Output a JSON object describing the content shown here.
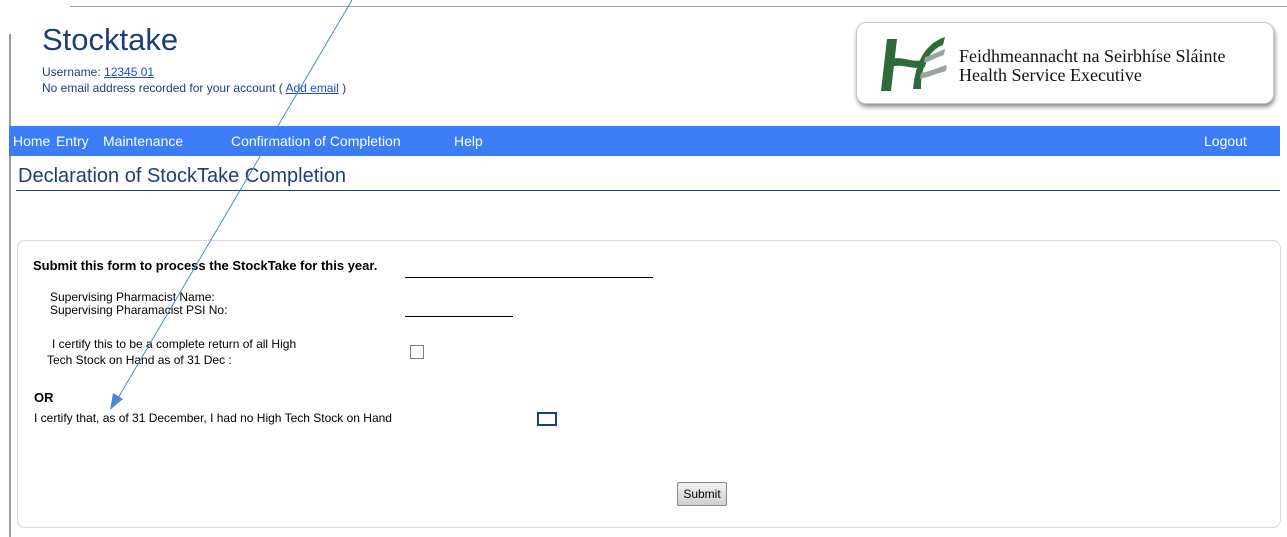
{
  "app": {
    "title": "Stocktake",
    "username_label": "Username:",
    "username_value": "12345 01",
    "email_notice_prefix": "No email address recorded for your account (",
    "email_link": "Add email",
    "email_notice_suffix": ")"
  },
  "logo": {
    "line1": "Feidhmeannacht na Seirbhíse Sláinte",
    "line2": "Health Service Executive"
  },
  "nav": {
    "items": [
      "Home",
      "Entry",
      "Maintenance",
      "Confirmation of Completion",
      "Help"
    ],
    "logout": "Logout",
    "bar_color": "#3b7df6"
  },
  "page": {
    "heading": "Declaration of StockTake Completion"
  },
  "form": {
    "intro": "Submit this form to process the StockTake for this year.",
    "pharmacist_name_label": "Supervising Pharmacist Name:",
    "pharmacist_name_value": "",
    "psi_label": "Supervising Pharamacist PSI No:",
    "psi_value": "",
    "certify_return_line1": "I certify this to be a complete return of all High",
    "certify_return_line2": "Tech Stock on Hand as of 31 Dec :",
    "certify_return_checked": false,
    "or_label": "OR",
    "certify_none_label": "I certify that, as of 31 December, I had no High Tech Stock on Hand",
    "certify_none_checked": false,
    "submit_label": "Submit"
  }
}
